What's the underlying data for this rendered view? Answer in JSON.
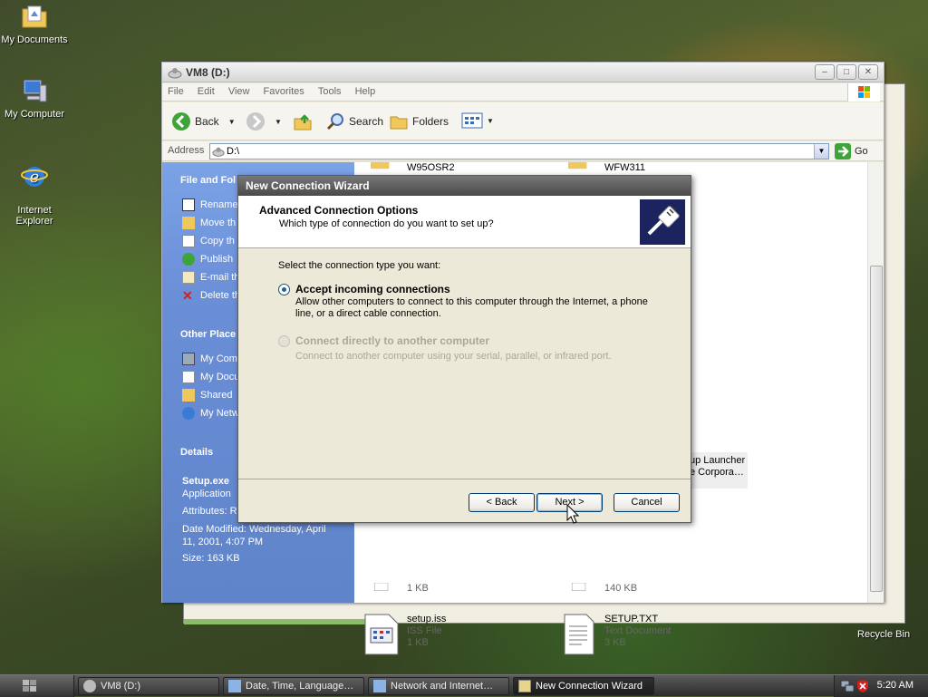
{
  "desktop": {
    "icons": [
      {
        "label": "My Documents"
      },
      {
        "label": "My Computer"
      },
      {
        "label": "Internet\nExplorer"
      }
    ],
    "recycle_bin": "Recycle Bin"
  },
  "explorer": {
    "title": "VM8 (D:)",
    "menu": [
      "File",
      "Edit",
      "View",
      "Favorites",
      "Tools",
      "Help"
    ],
    "toolbar": {
      "back": "Back",
      "search": "Search",
      "folders": "Folders"
    },
    "address": {
      "label": "Address",
      "value": "D:\\",
      "go": "Go"
    },
    "tasks": {
      "file_folder_header": "File and Fol",
      "file_tasks": [
        "Rename",
        "Move th",
        "Copy th",
        "Publish",
        "E-mail th",
        "Delete th"
      ],
      "other_places_header": "Other Place",
      "other_places": [
        "My Com",
        "My Docu",
        "Shared",
        "My Netw"
      ],
      "details_header": "Details",
      "details": {
        "name": "Setup.exe",
        "type": "Application",
        "attributes": "Attributes: R",
        "modified": "Date Modified: Wednesday, April 11, 2001, 4:07 PM",
        "size": "Size: 163 KB"
      }
    },
    "files": [
      {
        "name": "W95OSR2"
      },
      {
        "name": "WFW311"
      },
      {
        "name": "up Launcher",
        "line2": "e Corpora…"
      },
      {
        "name": "1 KB"
      },
      {
        "name": "140 KB"
      },
      {
        "name": "setup.iss",
        "type": "ISS File",
        "size": "1 KB"
      },
      {
        "name": "SETUP.TXT",
        "type": "Text Document",
        "size": "3 KB"
      }
    ]
  },
  "wizard": {
    "title": "New Connection Wizard",
    "header_title": "Advanced Connection Options",
    "header_subtitle": "Which type of connection do you want to set up?",
    "prompt": "Select the connection type you want:",
    "options": [
      {
        "label": "Accept incoming connections",
        "desc": "Allow other computers to connect to this computer through the Internet, a phone line, or a direct cable connection.",
        "selected": true,
        "enabled": true
      },
      {
        "label": "Connect directly to another computer",
        "desc": "Connect to another computer using your serial, parallel, or infrared port.",
        "selected": false,
        "enabled": false
      }
    ],
    "buttons": {
      "back": "< Back",
      "next": "Next >",
      "cancel": "Cancel"
    }
  },
  "taskbar": {
    "items": [
      {
        "label": "VM8 (D:)"
      },
      {
        "label": "Date, Time, Language…"
      },
      {
        "label": "Network and Internet…"
      },
      {
        "label": "New Connection Wizard",
        "active": true
      }
    ],
    "clock": "5:20 AM"
  }
}
